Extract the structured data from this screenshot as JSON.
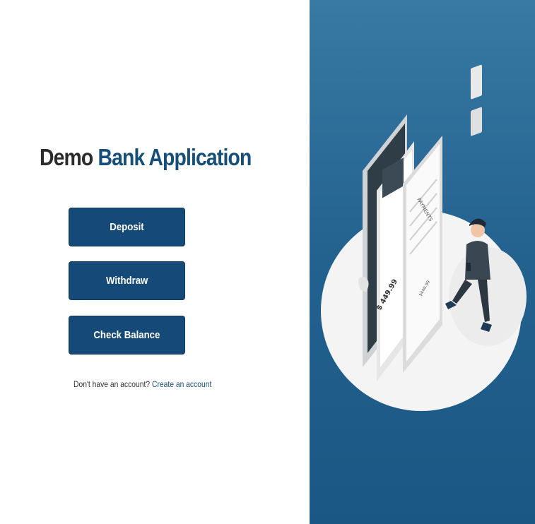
{
  "header": {
    "title_part1": "Demo",
    "title_part2": "Bank Application"
  },
  "actions": {
    "deposit_label": "Deposit",
    "withdraw_label": "Withdraw",
    "balance_label": "Check Balance"
  },
  "signup": {
    "prompt": "Don't have an account?",
    "link_label": "Create an account"
  },
  "illustration": {
    "icon": "mobile-payment-illustration",
    "screen_heading": "PAYMENTS",
    "amount_text": "$ 449.99",
    "balance_text": "$449.99"
  },
  "colors": {
    "primary": "#154a78",
    "accent_text": "#154f7a",
    "panel_top": "#387aa4",
    "panel_bottom": "#1b5784"
  }
}
